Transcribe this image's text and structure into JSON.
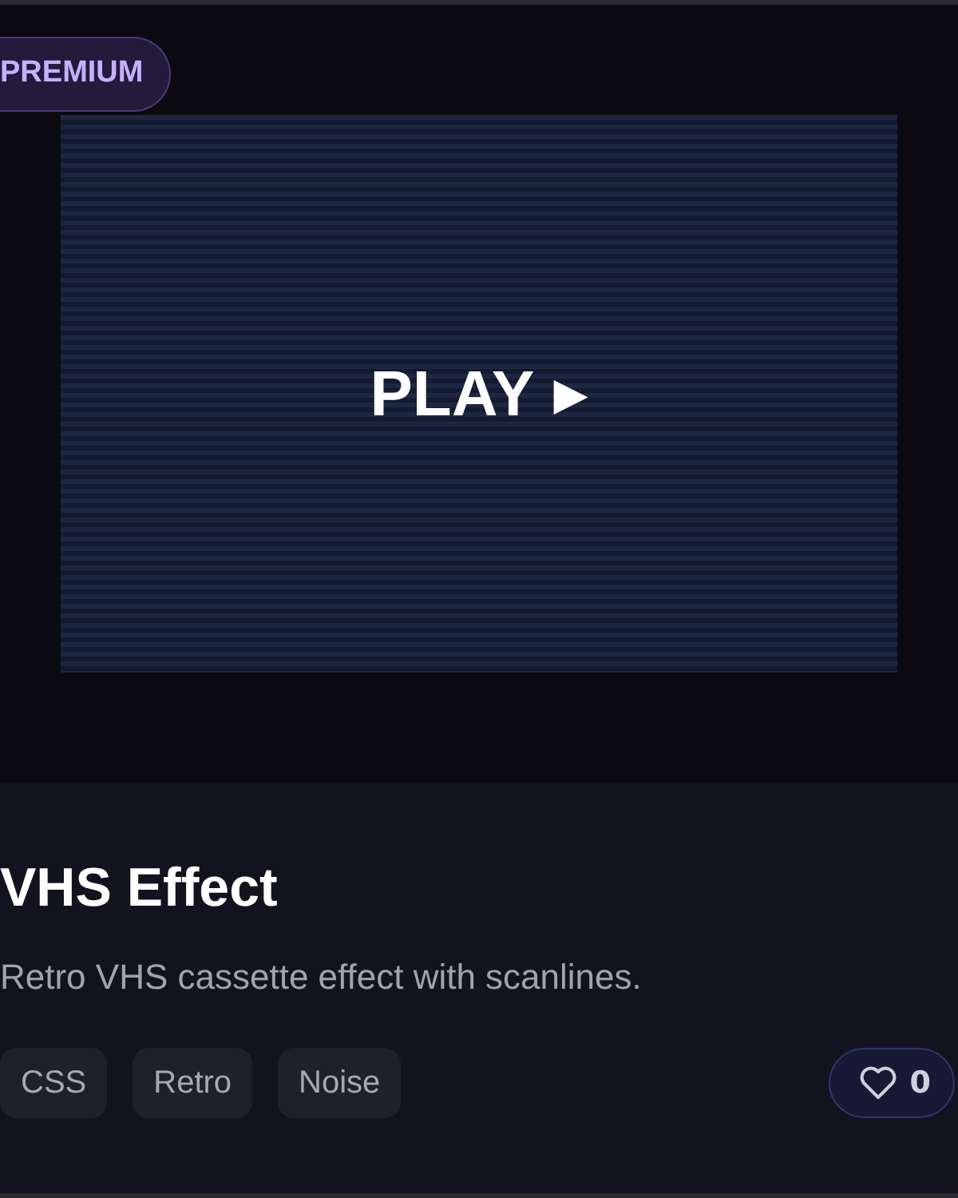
{
  "badge": "PREMIUM",
  "preview": {
    "label": "PLAY",
    "icon": "▶"
  },
  "title": "VHS Effect",
  "description": "Retro VHS cassette effect with scanlines.",
  "tags": [
    "CSS",
    "Retro",
    "Noise"
  ],
  "likes": "0"
}
